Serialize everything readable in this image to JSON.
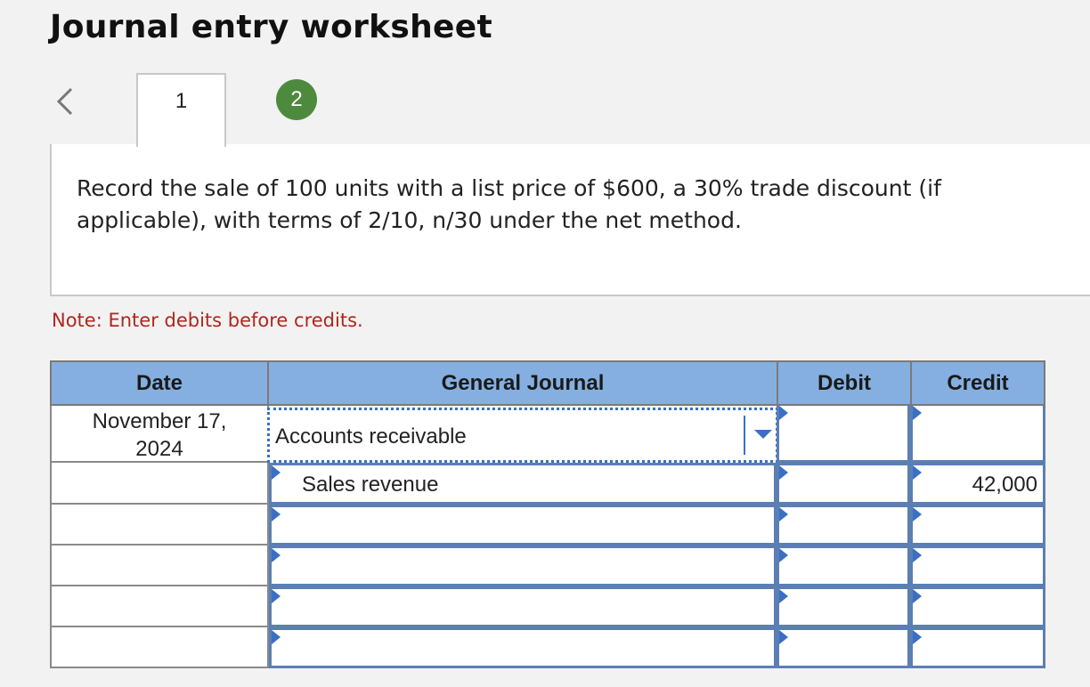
{
  "page": {
    "title": "Journal entry worksheet"
  },
  "tabs": [
    {
      "label": "1",
      "active": true
    },
    {
      "label": "2",
      "active": false
    }
  ],
  "instructions": "Record the sale of 100 units with a list price of $600, a 30% trade discount (if applicable), with terms of 2/10, n/30 under the net method.",
  "note": "Note: Enter debits before credits.",
  "journal": {
    "headers": {
      "date": "Date",
      "account": "General Journal",
      "debit": "Debit",
      "credit": "Credit"
    },
    "rows": [
      {
        "date_line1": "November 17,",
        "date_line2": "2024",
        "account": "Accounts receivable",
        "debit": "",
        "credit": ""
      },
      {
        "date_line1": "",
        "date_line2": "",
        "account": "Sales revenue",
        "debit": "",
        "credit": "42,000"
      },
      {
        "date_line1": "",
        "date_line2": "",
        "account": "",
        "debit": "",
        "credit": ""
      },
      {
        "date_line1": "",
        "date_line2": "",
        "account": "",
        "debit": "",
        "credit": ""
      },
      {
        "date_line1": "",
        "date_line2": "",
        "account": "",
        "debit": "",
        "credit": ""
      },
      {
        "date_line1": "",
        "date_line2": "",
        "account": "",
        "debit": "",
        "credit": ""
      }
    ]
  },
  "colors": {
    "header_bg": "#85afe0",
    "cell_border": "#5b7fb4",
    "note": "#b0261e",
    "tab_badge": "#4e8a3e"
  }
}
